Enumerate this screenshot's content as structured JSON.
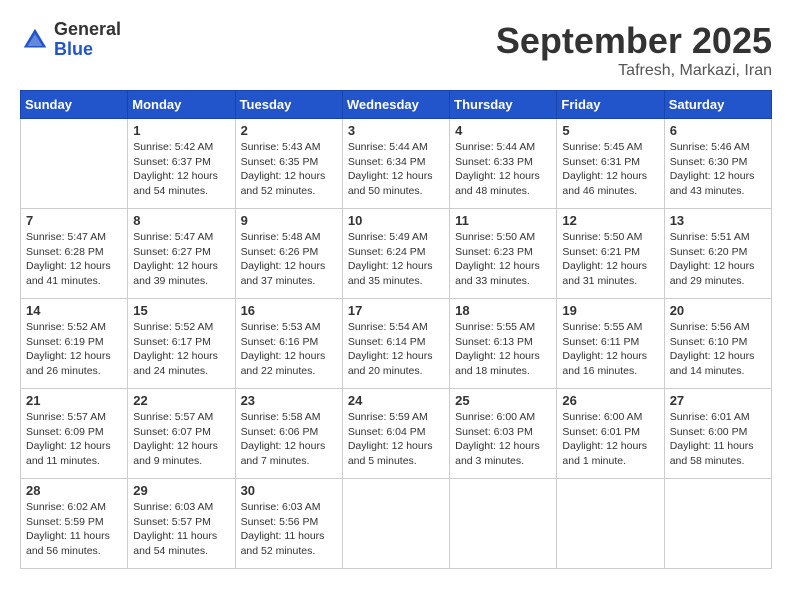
{
  "header": {
    "logo_general": "General",
    "logo_blue": "Blue",
    "title": "September 2025",
    "location": "Tafresh, Markazi, Iran"
  },
  "days_of_week": [
    "Sunday",
    "Monday",
    "Tuesday",
    "Wednesday",
    "Thursday",
    "Friday",
    "Saturday"
  ],
  "weeks": [
    [
      {
        "day": "",
        "info": ""
      },
      {
        "day": "1",
        "info": "Sunrise: 5:42 AM\nSunset: 6:37 PM\nDaylight: 12 hours\nand 54 minutes."
      },
      {
        "day": "2",
        "info": "Sunrise: 5:43 AM\nSunset: 6:35 PM\nDaylight: 12 hours\nand 52 minutes."
      },
      {
        "day": "3",
        "info": "Sunrise: 5:44 AM\nSunset: 6:34 PM\nDaylight: 12 hours\nand 50 minutes."
      },
      {
        "day": "4",
        "info": "Sunrise: 5:44 AM\nSunset: 6:33 PM\nDaylight: 12 hours\nand 48 minutes."
      },
      {
        "day": "5",
        "info": "Sunrise: 5:45 AM\nSunset: 6:31 PM\nDaylight: 12 hours\nand 46 minutes."
      },
      {
        "day": "6",
        "info": "Sunrise: 5:46 AM\nSunset: 6:30 PM\nDaylight: 12 hours\nand 43 minutes."
      }
    ],
    [
      {
        "day": "7",
        "info": "Sunrise: 5:47 AM\nSunset: 6:28 PM\nDaylight: 12 hours\nand 41 minutes."
      },
      {
        "day": "8",
        "info": "Sunrise: 5:47 AM\nSunset: 6:27 PM\nDaylight: 12 hours\nand 39 minutes."
      },
      {
        "day": "9",
        "info": "Sunrise: 5:48 AM\nSunset: 6:26 PM\nDaylight: 12 hours\nand 37 minutes."
      },
      {
        "day": "10",
        "info": "Sunrise: 5:49 AM\nSunset: 6:24 PM\nDaylight: 12 hours\nand 35 minutes."
      },
      {
        "day": "11",
        "info": "Sunrise: 5:50 AM\nSunset: 6:23 PM\nDaylight: 12 hours\nand 33 minutes."
      },
      {
        "day": "12",
        "info": "Sunrise: 5:50 AM\nSunset: 6:21 PM\nDaylight: 12 hours\nand 31 minutes."
      },
      {
        "day": "13",
        "info": "Sunrise: 5:51 AM\nSunset: 6:20 PM\nDaylight: 12 hours\nand 29 minutes."
      }
    ],
    [
      {
        "day": "14",
        "info": "Sunrise: 5:52 AM\nSunset: 6:19 PM\nDaylight: 12 hours\nand 26 minutes."
      },
      {
        "day": "15",
        "info": "Sunrise: 5:52 AM\nSunset: 6:17 PM\nDaylight: 12 hours\nand 24 minutes."
      },
      {
        "day": "16",
        "info": "Sunrise: 5:53 AM\nSunset: 6:16 PM\nDaylight: 12 hours\nand 22 minutes."
      },
      {
        "day": "17",
        "info": "Sunrise: 5:54 AM\nSunset: 6:14 PM\nDaylight: 12 hours\nand 20 minutes."
      },
      {
        "day": "18",
        "info": "Sunrise: 5:55 AM\nSunset: 6:13 PM\nDaylight: 12 hours\nand 18 minutes."
      },
      {
        "day": "19",
        "info": "Sunrise: 5:55 AM\nSunset: 6:11 PM\nDaylight: 12 hours\nand 16 minutes."
      },
      {
        "day": "20",
        "info": "Sunrise: 5:56 AM\nSunset: 6:10 PM\nDaylight: 12 hours\nand 14 minutes."
      }
    ],
    [
      {
        "day": "21",
        "info": "Sunrise: 5:57 AM\nSunset: 6:09 PM\nDaylight: 12 hours\nand 11 minutes."
      },
      {
        "day": "22",
        "info": "Sunrise: 5:57 AM\nSunset: 6:07 PM\nDaylight: 12 hours\nand 9 minutes."
      },
      {
        "day": "23",
        "info": "Sunrise: 5:58 AM\nSunset: 6:06 PM\nDaylight: 12 hours\nand 7 minutes."
      },
      {
        "day": "24",
        "info": "Sunrise: 5:59 AM\nSunset: 6:04 PM\nDaylight: 12 hours\nand 5 minutes."
      },
      {
        "day": "25",
        "info": "Sunrise: 6:00 AM\nSunset: 6:03 PM\nDaylight: 12 hours\nand 3 minutes."
      },
      {
        "day": "26",
        "info": "Sunrise: 6:00 AM\nSunset: 6:01 PM\nDaylight: 12 hours\nand 1 minute."
      },
      {
        "day": "27",
        "info": "Sunrise: 6:01 AM\nSunset: 6:00 PM\nDaylight: 11 hours\nand 58 minutes."
      }
    ],
    [
      {
        "day": "28",
        "info": "Sunrise: 6:02 AM\nSunset: 5:59 PM\nDaylight: 11 hours\nand 56 minutes."
      },
      {
        "day": "29",
        "info": "Sunrise: 6:03 AM\nSunset: 5:57 PM\nDaylight: 11 hours\nand 54 minutes."
      },
      {
        "day": "30",
        "info": "Sunrise: 6:03 AM\nSunset: 5:56 PM\nDaylight: 11 hours\nand 52 minutes."
      },
      {
        "day": "",
        "info": ""
      },
      {
        "day": "",
        "info": ""
      },
      {
        "day": "",
        "info": ""
      },
      {
        "day": "",
        "info": ""
      }
    ]
  ]
}
